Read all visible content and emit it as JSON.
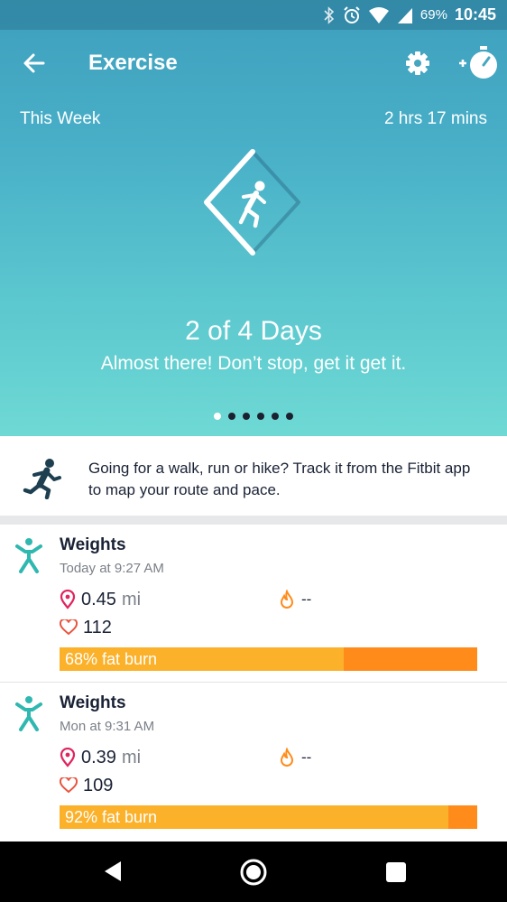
{
  "status_bar": {
    "battery": "69%",
    "time": "10:45",
    "icons": [
      "bluetooth-icon",
      "alarm-icon",
      "wifi-icon",
      "signal-icon"
    ]
  },
  "app_bar": {
    "title": "Exercise",
    "back_icon": "arrow-left-icon",
    "settings_icon": "gear-icon",
    "timer_icon": "stopwatch-add-icon"
  },
  "summary": {
    "period_label": "This Week",
    "total_time": "2 hrs 17 mins",
    "days_progress": "2 of 4 Days",
    "message": "Almost there! Don’t stop, get it get it.",
    "page_count": 6,
    "active_page": 0
  },
  "tip": {
    "text": "Going for a walk, run or hike? Track it from the Fitbit app to map your route and pace."
  },
  "activities": [
    {
      "name": "Weights",
      "time": "Today at 9:27 AM",
      "distance": "0.45",
      "distance_unit": "mi",
      "calories": "--",
      "heart_rate": "112",
      "fat_burn_label": "68% fat burn",
      "fat_burn_fraction": 0.68
    },
    {
      "name": "Weights",
      "time": "Mon at 9:31 AM",
      "distance": "0.39",
      "distance_unit": "mi",
      "calories": "--",
      "heart_rate": "109",
      "fat_burn_label": "92% fat burn",
      "fat_burn_fraction": 0.93
    }
  ],
  "colors": {
    "accent_teal": "#2fb8b0",
    "fat_burn": "#fcb12a",
    "cardio": "#ff8c1a",
    "location_pin": "#e0245e",
    "heart": "#e8553f",
    "flame": "#ff8c1a"
  }
}
